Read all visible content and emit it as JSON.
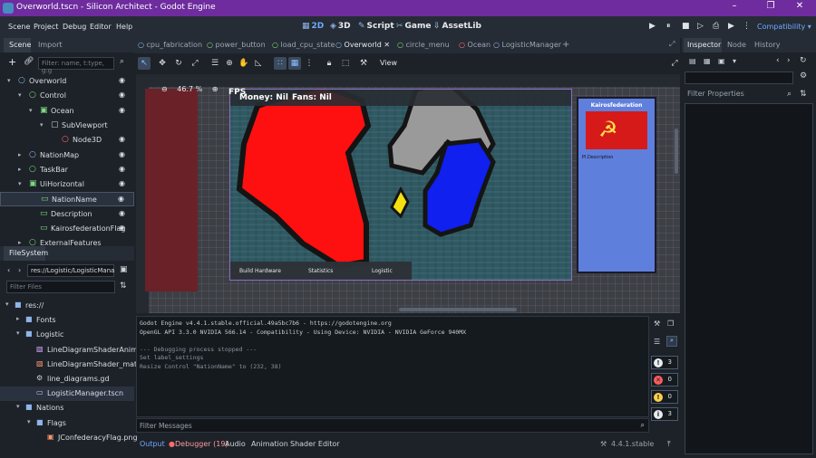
{
  "window": {
    "title": "Overworld.tscn - Silicon Architect - Godot Engine",
    "controls": [
      "–",
      "❐",
      "✕"
    ]
  },
  "menu": [
    "Scene",
    "Project",
    "Debug",
    "Editor",
    "Help"
  ],
  "workspaces": [
    {
      "icon": "▦",
      "label": "2D"
    },
    {
      "icon": "◈",
      "label": "3D"
    },
    {
      "icon": "✎",
      "label": "Script"
    },
    {
      "icon": "✂",
      "label": "Game"
    },
    {
      "icon": "⇩",
      "label": "AssetLib"
    }
  ],
  "run_controls": [
    "▶",
    "⏸",
    "■",
    "▷",
    "⎙",
    "▶",
    "⋮"
  ],
  "renderer": "Compatibility ▾",
  "scene_dock": {
    "tabs": [
      "Scene",
      "Import"
    ],
    "filter_placeholder": "Filter: name, t:type, g:g",
    "tree": [
      {
        "label": "Overworld",
        "icon": "○",
        "icon_color": "#8fb4e8",
        "depth": 0,
        "arrow": "▾",
        "eye": true
      },
      {
        "label": "Control",
        "icon": "○",
        "icon_color": "#7ed97e",
        "depth": 1,
        "arrow": "▾",
        "eye": true
      },
      {
        "label": "Ocean",
        "icon": "▣",
        "icon_color": "#7ed97e",
        "depth": 2,
        "arrow": "▾",
        "eye": true
      },
      {
        "label": "SubViewport",
        "icon": "▢",
        "icon_color": "#c9ced6",
        "depth": 3,
        "arrow": "▾",
        "eye": false
      },
      {
        "label": "Node3D",
        "icon": "○",
        "icon_color": "#ff6b6b",
        "depth": 4,
        "arrow": "",
        "eye": true
      },
      {
        "label": "NationMap",
        "icon": "○",
        "icon_color": "#8fb4e8",
        "depth": 1,
        "arrow": "▸",
        "eye": true
      },
      {
        "label": "TaskBar",
        "icon": "○",
        "icon_color": "#7ed97e",
        "depth": 1,
        "arrow": "▸",
        "eye": true
      },
      {
        "label": "UiHorizontal",
        "icon": "▣",
        "icon_color": "#7ed97e",
        "depth": 1,
        "arrow": "▾",
        "eye": true
      },
      {
        "label": "NationName",
        "icon": "▭",
        "icon_color": "#7ed97e",
        "depth": 2,
        "arrow": "",
        "eye": true,
        "selected": true
      },
      {
        "label": "Description",
        "icon": "▭",
        "icon_color": "#7ed97e",
        "depth": 2,
        "arrow": "",
        "eye": true
      },
      {
        "label": "KairosfederationFlag",
        "icon": "▭",
        "icon_color": "#7ed97e",
        "depth": 2,
        "arrow": "",
        "eye": true
      },
      {
        "label": "ExternalFeatures",
        "icon": "○",
        "icon_color": "#7ed97e",
        "depth": 1,
        "arrow": "▸",
        "eye": false
      }
    ]
  },
  "filesystem": {
    "title": "FileSystem",
    "path": "res://Logistic/LogisticMana",
    "filter_placeholder": "Filter Files",
    "items": [
      {
        "label": "res://",
        "icon": "■",
        "icon_color": "#8fb4e8",
        "depth": 0,
        "arrow": "▾"
      },
      {
        "label": "Fonts",
        "icon": "■",
        "icon_color": "#8fb4e8",
        "depth": 1,
        "arrow": "▸"
      },
      {
        "label": "Logistic",
        "icon": "■",
        "icon_color": "#8fb4e8",
        "depth": 1,
        "arrow": "▾"
      },
      {
        "label": "LineDiagramShaderAnima...",
        "icon": "▧",
        "icon_color": "#d9a8ff",
        "depth": 2,
        "arrow": ""
      },
      {
        "label": "LineDiagramShader_mater...",
        "icon": "▧",
        "icon_color": "#ff9a6b",
        "depth": 2,
        "arrow": ""
      },
      {
        "label": "line_diagrams.gd",
        "icon": "⚙",
        "icon_color": "#c9ced6",
        "depth": 2,
        "arrow": ""
      },
      {
        "label": "LogisticManager.tscn",
        "icon": "▭",
        "icon_color": "#c9ced6",
        "depth": 2,
        "arrow": "",
        "selected": true
      },
      {
        "label": "Nations",
        "icon": "■",
        "icon_color": "#8fb4e8",
        "depth": 1,
        "arrow": "▾"
      },
      {
        "label": "Flags",
        "icon": "■",
        "icon_color": "#8fb4e8",
        "depth": 2,
        "arrow": "▾"
      },
      {
        "label": "JConfederacyFlag.png",
        "icon": "▣",
        "icon_color": "#ff9a6b",
        "depth": 3,
        "arrow": ""
      }
    ]
  },
  "editor_tabs": [
    {
      "label": "cpu_fabrication",
      "color": "#8fb4e8"
    },
    {
      "label": "power_button",
      "color": "#7ed97e"
    },
    {
      "label": "load_cpu_state",
      "color": "#7ed97e"
    },
    {
      "label": "Overworld",
      "color": "#8fb4e8",
      "active": true
    },
    {
      "label": "circle_menu",
      "color": "#7ed97e"
    },
    {
      "label": "Ocean",
      "color": "#ff6b6b"
    },
    {
      "label": "LogisticManager",
      "color": "#8fb4e8"
    }
  ],
  "toolbar": {
    "view_label": "View"
  },
  "viewport": {
    "zoom": "46.7 %",
    "fps": "FPS",
    "money": "Money: Nil",
    "fans": "Fans: Nil",
    "taskbar": [
      "Build Hardware",
      "Statistics",
      "Logistic"
    ],
    "nation_name": "Kairosfederation",
    "description": "Pl.Description"
  },
  "output": {
    "lines": [
      "Godot Engine v4.4.1.stable.official.49a5bc7b6 - https://godotengine.org",
      "OpenGL API 3.3.0 NVIDIA 566.14 - Compatibility - Using Device: NVIDIA - NVIDIA GeForce 940MX",
      "",
      "--- Debugging process stopped ---",
      "Set label_settings",
      "Resize Control \"NationName\" to (232, 38)"
    ],
    "filter_placeholder": "Filter Messages",
    "counts": [
      {
        "icon": "!",
        "color": "#e8ebef",
        "value": "3"
      },
      {
        "icon": "✕",
        "color": "#ff5c5c",
        "value": "0"
      },
      {
        "icon": "!",
        "color": "#ffcf4a",
        "value": "0"
      },
      {
        "icon": "i",
        "color": "#e8ebef",
        "value": "3"
      }
    ]
  },
  "bottom_tabs": [
    "Output",
    "Debugger (19)",
    "Audio",
    "Animation",
    "Shader Editor"
  ],
  "version": "4.4.1.stable",
  "inspector": {
    "tabs": [
      "Inspector",
      "Node",
      "History"
    ],
    "filter_placeholder": "Filter Properties"
  }
}
